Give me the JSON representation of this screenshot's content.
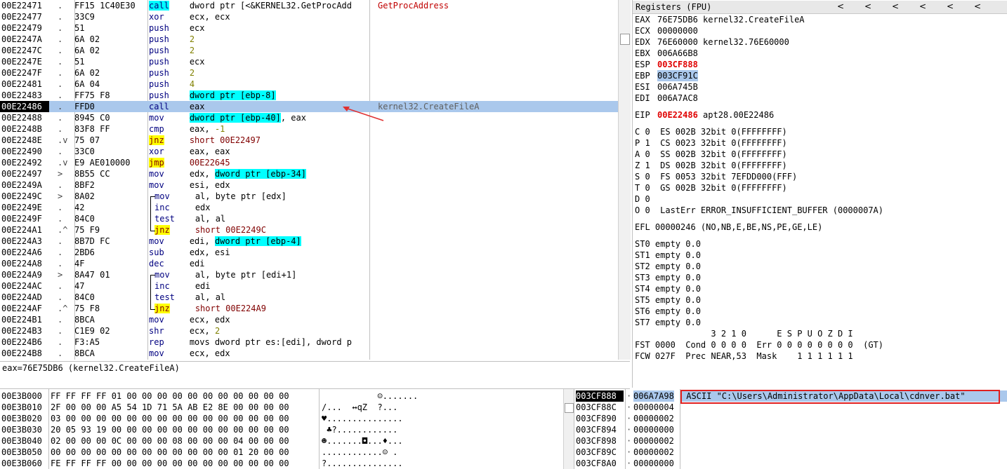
{
  "disasm": {
    "rows": [
      {
        "addr": "00E22471",
        "mark": ".",
        "hex": "FF15 1C40E30",
        "mn": "call",
        "mn_style": "call",
        "ops": [
          {
            "t": "dword ptr [<&KERNEL32.GetProcAdd",
            "s": "plain"
          }
        ],
        "cmt": "GetProcAddress",
        "cmt_style": "red"
      },
      {
        "addr": "00E22477",
        "mark": ".",
        "hex": "33C9",
        "mn": "xor",
        "ops": [
          {
            "t": "ecx, ecx",
            "s": "plain"
          }
        ]
      },
      {
        "addr": "00E22479",
        "mark": ".",
        "hex": "51",
        "mn": "push",
        "ops": [
          {
            "t": "ecx",
            "s": "plain"
          }
        ]
      },
      {
        "addr": "00E2247A",
        "mark": ".",
        "hex": "6A 02",
        "mn": "push",
        "ops": [
          {
            "t": "2",
            "s": "num"
          }
        ]
      },
      {
        "addr": "00E2247C",
        "mark": ".",
        "hex": "6A 02",
        "mn": "push",
        "ops": [
          {
            "t": "2",
            "s": "num"
          }
        ]
      },
      {
        "addr": "00E2247E",
        "mark": ".",
        "hex": "51",
        "mn": "push",
        "ops": [
          {
            "t": "ecx",
            "s": "plain"
          }
        ]
      },
      {
        "addr": "00E2247F",
        "mark": ".",
        "hex": "6A 02",
        "mn": "push",
        "ops": [
          {
            "t": "2",
            "s": "num"
          }
        ]
      },
      {
        "addr": "00E22481",
        "mark": ".",
        "hex": "6A 04",
        "mn": "push",
        "ops": [
          {
            "t": "4",
            "s": "num"
          }
        ]
      },
      {
        "addr": "00E22483",
        "mark": ".",
        "hex": "FF75 F8",
        "mn": "push",
        "ops": [
          {
            "t": "dword ptr [ebp-8]",
            "s": "mem"
          }
        ]
      },
      {
        "addr": "00E22486",
        "mark": ".",
        "hex": "FFD0",
        "mn": "call",
        "ops": [
          {
            "t": "eax",
            "s": "plain"
          }
        ],
        "cmt": "kernel32.CreateFileA",
        "cmt_style": "gray",
        "sel": true,
        "cur": true
      },
      {
        "addr": "00E22488",
        "mark": ".",
        "hex": "8945 C0",
        "mn": "mov",
        "ops": [
          {
            "t": "dword ptr [ebp-40]",
            "s": "mem"
          },
          {
            "t": ", eax",
            "s": "plain"
          }
        ]
      },
      {
        "addr": "00E2248B",
        "mark": ".",
        "hex": "83F8 FF",
        "mn": "cmp",
        "ops": [
          {
            "t": "eax, ",
            "s": "plain"
          },
          {
            "t": "-1",
            "s": "num"
          }
        ]
      },
      {
        "addr": "00E2248E",
        "mark": ".v",
        "hex": "75 07",
        "mn": "jnz",
        "mn_style": "jmp",
        "ops": [
          {
            "t": "short 00E22497",
            "s": "lbl"
          }
        ]
      },
      {
        "addr": "00E22490",
        "mark": ".",
        "hex": "33C0",
        "mn": "xor",
        "ops": [
          {
            "t": "eax, eax",
            "s": "plain"
          }
        ]
      },
      {
        "addr": "00E22492",
        "mark": ".v",
        "hex": "E9 AE010000",
        "mn": "jmp",
        "mn_style": "jmp",
        "ops": [
          {
            "t": "00E22645",
            "s": "lbl"
          }
        ]
      },
      {
        "addr": "00E22497",
        "mark": ">",
        "hex": "8B55 CC",
        "mn": "mov",
        "ops": [
          {
            "t": "edx, ",
            "s": "plain"
          },
          {
            "t": "dword ptr [ebp-34]",
            "s": "mem"
          }
        ]
      },
      {
        "addr": "00E2249A",
        "mark": ".",
        "hex": "8BF2",
        "mn": "mov",
        "ops": [
          {
            "t": "esi, edx",
            "s": "plain"
          }
        ]
      },
      {
        "addr": "00E2249C",
        "mark": ">",
        "hex": "8A02",
        "mn": "mov",
        "ops": [
          {
            "t": "al, byte ptr [edx]",
            "s": "plain"
          }
        ],
        "indent": true
      },
      {
        "addr": "00E2249E",
        "mark": ".",
        "hex": "42",
        "mn": "inc",
        "ops": [
          {
            "t": "edx",
            "s": "plain"
          }
        ],
        "indent": true
      },
      {
        "addr": "00E2249F",
        "mark": ".",
        "hex": "84C0",
        "mn": "test",
        "ops": [
          {
            "t": "al, al",
            "s": "plain"
          }
        ],
        "indent": true
      },
      {
        "addr": "00E224A1",
        "mark": ".^",
        "hex": "75 F9",
        "mn": "jnz",
        "mn_style": "jmp",
        "ops": [
          {
            "t": "short 00E2249C",
            "s": "lbl"
          }
        ],
        "indent": true
      },
      {
        "addr": "00E224A3",
        "mark": ".",
        "hex": "8B7D FC",
        "mn": "mov",
        "ops": [
          {
            "t": "edi, ",
            "s": "plain"
          },
          {
            "t": "dword ptr [ebp-4]",
            "s": "mem"
          }
        ]
      },
      {
        "addr": "00E224A6",
        "mark": ".",
        "hex": "2BD6",
        "mn": "sub",
        "ops": [
          {
            "t": "edx, esi",
            "s": "plain"
          }
        ]
      },
      {
        "addr": "00E224A8",
        "mark": ".",
        "hex": "4F",
        "mn": "dec",
        "ops": [
          {
            "t": "edi",
            "s": "plain"
          }
        ]
      },
      {
        "addr": "00E224A9",
        "mark": ">",
        "hex": "8A47 01",
        "mn": "mov",
        "ops": [
          {
            "t": "al, byte ptr [edi+1]",
            "s": "plain"
          }
        ],
        "indent": true
      },
      {
        "addr": "00E224AC",
        "mark": ".",
        "hex": "47",
        "mn": "inc",
        "ops": [
          {
            "t": "edi",
            "s": "plain"
          }
        ],
        "indent": true
      },
      {
        "addr": "00E224AD",
        "mark": ".",
        "hex": "84C0",
        "mn": "test",
        "ops": [
          {
            "t": "al, al",
            "s": "plain"
          }
        ],
        "indent": true
      },
      {
        "addr": "00E224AF",
        "mark": ".^",
        "hex": "75 F8",
        "mn": "jnz",
        "mn_style": "jmp",
        "ops": [
          {
            "t": "short 00E224A9",
            "s": "lbl"
          }
        ],
        "indent": true
      },
      {
        "addr": "00E224B1",
        "mark": ".",
        "hex": "8BCA",
        "mn": "mov",
        "ops": [
          {
            "t": "ecx, edx",
            "s": "plain"
          }
        ]
      },
      {
        "addr": "00E224B3",
        "mark": ".",
        "hex": "C1E9 02",
        "mn": "shr",
        "ops": [
          {
            "t": "ecx, ",
            "s": "plain"
          },
          {
            "t": "2",
            "s": "num"
          }
        ]
      },
      {
        "addr": "00E224B6",
        "mark": ".",
        "hex": "F3:A5",
        "mn": "rep",
        "ops": [
          {
            "t": "movs dword ptr es:[edi], dword p",
            "s": "plain"
          }
        ]
      },
      {
        "addr": "00E224B8",
        "mark": ".",
        "hex": "8BCA",
        "mn": "mov",
        "ops": [
          {
            "t": "ecx, edx",
            "s": "plain"
          }
        ]
      }
    ]
  },
  "infobar": {
    "text": "eax=76E75DB6 (kernel32.CreateFileA)"
  },
  "registers": {
    "title": "Registers (FPU)",
    "arrows": [
      "<",
      "<",
      "<",
      "<",
      "<",
      "<"
    ],
    "general": [
      {
        "name": "EAX",
        "val": "76E75DB6",
        "cmt": "kernel32.CreateFileA"
      },
      {
        "name": "ECX",
        "val": "00000000",
        "cmt": ""
      },
      {
        "name": "EDX",
        "val": "76E60000",
        "cmt": "kernel32.76E60000"
      },
      {
        "name": "EBX",
        "val": "006A66B8",
        "cmt": ""
      },
      {
        "name": "ESP",
        "val": "003CF888",
        "cmt": "",
        "style": "red"
      },
      {
        "name": "EBP",
        "val": "003CF91C",
        "cmt": "",
        "style": "hl"
      },
      {
        "name": "ESI",
        "val": "006A745B",
        "cmt": ""
      },
      {
        "name": "EDI",
        "val": "006A7AC8",
        "cmt": ""
      }
    ],
    "eip": {
      "name": "EIP",
      "val": "00E22486",
      "cmt": "apt28.00E22486"
    },
    "flags": [
      "C 0  ES 002B 32bit 0(FFFFFFFF)",
      "P 1  CS 0023 32bit 0(FFFFFFFF)",
      "A 0  SS 002B 32bit 0(FFFFFFFF)",
      "Z 1  DS 002B 32bit 0(FFFFFFFF)",
      "S 0  FS 0053 32bit 7EFDD000(FFF)",
      "T 0  GS 002B 32bit 0(FFFFFFFF)",
      "D 0",
      "O 0  LastErr ERROR_INSUFFICIENT_BUFFER (0000007A)"
    ],
    "efl": "EFL 00000246 (NO,NB,E,BE,NS,PE,GE,LE)",
    "st": [
      "ST0 empty 0.0",
      "ST1 empty 0.0",
      "ST2 empty 0.0",
      "ST3 empty 0.0",
      "ST4 empty 0.0",
      "ST5 empty 0.0",
      "ST6 empty 0.0",
      "ST7 empty 0.0"
    ],
    "fpu_header": "               3 2 1 0      E S P U O Z D I",
    "fst": "FST 0000  Cond 0 0 0 0  Err 0 0 0 0 0 0 0 0  (GT)",
    "fcw": "FCW 027F  Prec NEAR,53  Mask    1 1 1 1 1 1"
  },
  "dump": {
    "rows": [
      {
        "addr": "00E3B000",
        "hex": "FF FF FF FF 01 00 00 00 00 00 00 00 00 00 00 00",
        "ascii": "           ☺......."
      },
      {
        "addr": "00E3B010",
        "hex": "2F 00 00 00 A5 54 1D 71 5A AB E2 8E 00 00 00 00",
        "ascii": "/...  ↔qZ  ?..."
      },
      {
        "addr": "00E3B020",
        "hex": "03 00 00 00 00 00 00 00 00 00 00 00 00 00 00 00",
        "ascii": "♥..............."
      },
      {
        "addr": "00E3B030",
        "hex": "20 05 93 19 00 00 00 00 00 00 00 00 00 00 00 00",
        "ascii": " ♣?............"
      },
      {
        "addr": "00E3B040",
        "hex": "02 00 00 00 0C 00 00 00 08 00 00 00 04 00 00 00",
        "ascii": "☻.......◘...♦..."
      },
      {
        "addr": "00E3B050",
        "hex": "00 00 00 00 00 00 00 00 00 00 00 00 01 20 00 00",
        "ascii": "............☺ ."
      },
      {
        "addr": "00E3B060",
        "hex": "FE FF FF FF 00 00 00 00 00 00 00 00 00 00 00 00",
        "ascii": "?..............."
      }
    ]
  },
  "stack": {
    "rows": [
      {
        "addr": "003CF888",
        "val": "006A7A98",
        "cmt": "ASCII \"C:\\Users\\Administrator\\AppData\\Local\\cdnver.bat\"",
        "top": true
      },
      {
        "addr": "003CF88C",
        "val": "00000004",
        "cmt": ""
      },
      {
        "addr": "003CF890",
        "val": "00000002",
        "cmt": ""
      },
      {
        "addr": "003CF894",
        "val": "00000000",
        "cmt": ""
      },
      {
        "addr": "003CF898",
        "val": "00000002",
        "cmt": ""
      },
      {
        "addr": "003CF89C",
        "val": "00000002",
        "cmt": ""
      },
      {
        "addr": "003CF8A0",
        "val": "00000000",
        "cmt": ""
      }
    ]
  },
  "colors": {
    "selection": "#aac8ec",
    "call_bg": "#00ffff",
    "jump_bg": "#ffff00",
    "annotation": "#e02020"
  }
}
